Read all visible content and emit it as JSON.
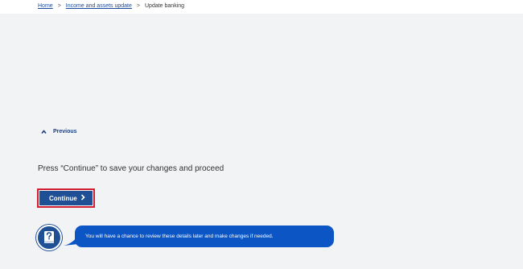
{
  "breadcrumb": {
    "items": [
      "Home",
      "Income and assets update",
      "Update banking"
    ],
    "separator": ">"
  },
  "previous": {
    "label": "Previous"
  },
  "instruction": {
    "text": "Press “Continue” to save your changes and proceed"
  },
  "continue": {
    "label": "Continue"
  },
  "help": {
    "message": "You will have a chance to review these details later and make changes if needed."
  },
  "icons": {
    "previous": "chevron-up-icon",
    "continue": "chevron-right-icon",
    "help": "question-book-icon"
  },
  "colors": {
    "primary": "#1f4f94",
    "bubble": "#0b55c4",
    "highlight": "#d21f32",
    "link": "#1a4a9c",
    "background": "#f2f3f5"
  }
}
